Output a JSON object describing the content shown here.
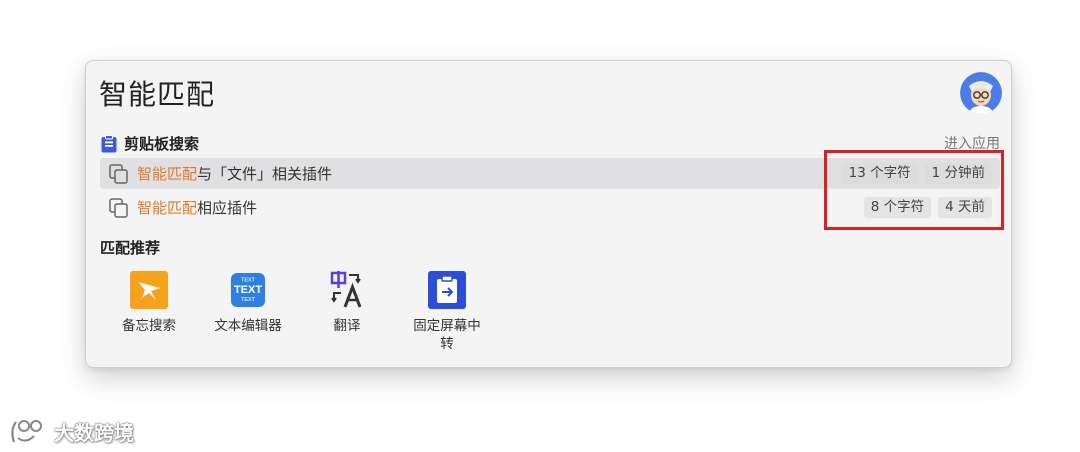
{
  "search": {
    "query": "智能匹配"
  },
  "clipboard_section": {
    "title": "剪贴板搜索",
    "enter_app_label": "进入应用",
    "results": [
      {
        "highlight": "智能匹配",
        "rest": "与「文件」相关插件",
        "char_count": "13 个字符",
        "time": "1 分钟前",
        "selected": true
      },
      {
        "highlight": "智能匹配",
        "rest": "相应插件",
        "char_count": "8 个字符",
        "time": "4 天前",
        "selected": false
      }
    ]
  },
  "recommend_section": {
    "title": "匹配推荐",
    "apps": [
      {
        "label": "备忘搜索",
        "icon": "memo-search-icon"
      },
      {
        "label": "文本编辑器",
        "icon": "text-editor-icon"
      },
      {
        "label": "翻译",
        "icon": "translate-icon"
      },
      {
        "label": "固定屏幕中转",
        "icon": "pin-screen-icon"
      }
    ]
  },
  "watermark": {
    "text": "大数跨境"
  },
  "colors": {
    "highlight": "#e07a2a",
    "annotation_red": "#d92128",
    "clipboard_blue": "#3b5bdb"
  }
}
